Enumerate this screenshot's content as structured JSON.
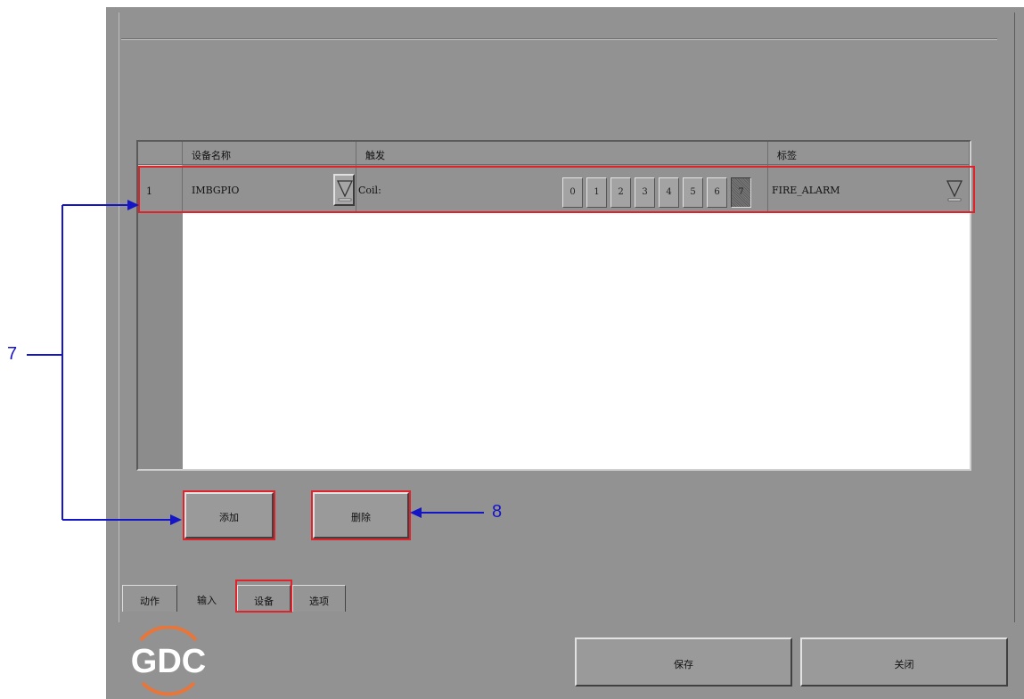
{
  "table": {
    "headers": [
      "",
      "设备名称",
      "触发",
      "标签"
    ],
    "rows": [
      {
        "num": "1",
        "device": "IMBGPIO",
        "trigger_prefix": "Coil:",
        "bits": [
          "0",
          "1",
          "2",
          "3",
          "4",
          "5",
          "6",
          "7"
        ],
        "active_bit": "7",
        "label": "FIRE_ALARM"
      }
    ]
  },
  "buttons": {
    "add": "添加",
    "delete": "删除",
    "save": "保存",
    "close": "关闭"
  },
  "tabs": [
    {
      "label": "动作",
      "active": false
    },
    {
      "label": "输入",
      "active": true
    },
    {
      "label": "设备",
      "active": false
    },
    {
      "label": "选项",
      "active": false
    }
  ],
  "logo": {
    "text": "GDC"
  },
  "annotations": {
    "callout_7": "7",
    "callout_8": "8"
  },
  "colors": {
    "panel": "#929292",
    "highlight": "#e0232a",
    "callout": "#1515c8",
    "logo_accent": "#e8763a"
  }
}
